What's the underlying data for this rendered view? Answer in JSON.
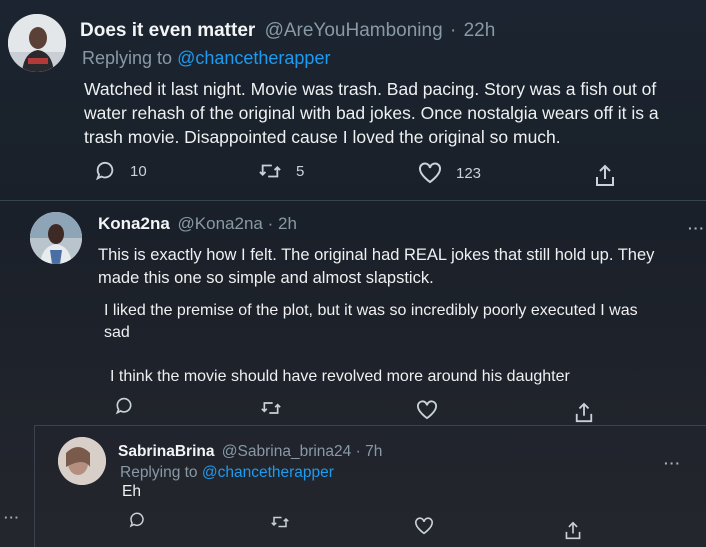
{
  "tweet1": {
    "display_name": "Does it even matter",
    "handle": "@AreYouHamboning",
    "sep": "·",
    "time": "22h",
    "replying_prefix": "Replying to",
    "replying_to": "@chancetherapper",
    "lines": [
      "Watched it last night. Movie was trash. Bad pacing. Story was a fish out of",
      "water rehash of the original with bad jokes. Once nostalgia wears off it is a",
      "trash movie. Disappointed cause I loved the original so much."
    ],
    "reply_count": "10",
    "retweet_count": "5",
    "like_count": "123"
  },
  "tweet2": {
    "display_name": "Kona2na",
    "handle": "@Kona2na",
    "sep": "·",
    "time": "2h",
    "para1": [
      "This is exactly how I felt. The original had REAL jokes that still hold up. They",
      "made this one so simple and almost slapstick."
    ],
    "para2": [
      "I liked the premise of the plot, but it was so incredibly poorly executed I was",
      "sad"
    ],
    "para3": [
      "I think the movie should have revolved more around his daughter"
    ]
  },
  "tweet3": {
    "display_name": "SabrinaBrina",
    "handle": "@Sabrina_brina24",
    "sep": "·",
    "time": "7h",
    "replying_prefix": "Replying to",
    "replying_to": "@chancetherapper",
    "text": "Eh"
  },
  "more_label": "···",
  "colors": {
    "background": "#15202b",
    "link": "#1d9bf0",
    "muted": "#8899a6",
    "divider": "#38444d"
  },
  "icons": [
    "reply-icon",
    "retweet-icon",
    "like-icon",
    "share-icon",
    "more-icon"
  ]
}
